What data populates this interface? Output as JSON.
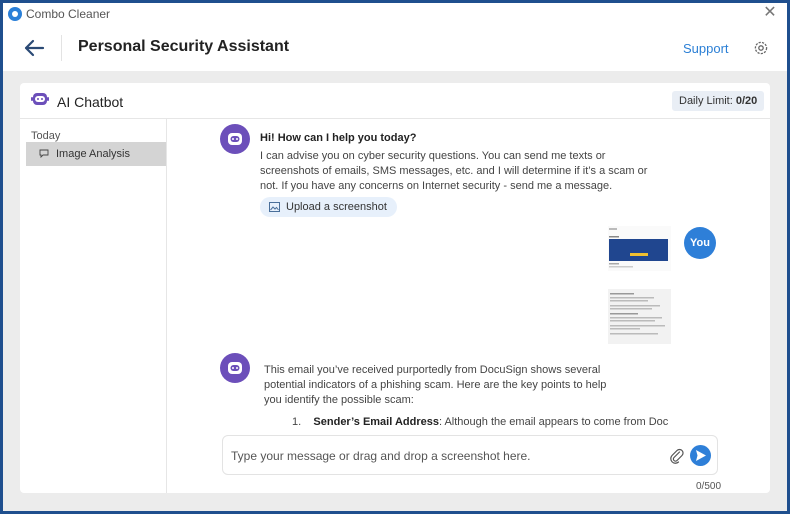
{
  "titlebar": {
    "app_name": "Combo Cleaner",
    "close_icon": "close-icon"
  },
  "header": {
    "title": "Personal Security Assistant",
    "support_label": "Support",
    "back_icon": "arrow-left-icon",
    "settings_icon": "gear-icon"
  },
  "panel": {
    "title": "AI Chatbot",
    "daily_limit_label": "Daily Limit: ",
    "daily_limit_value": "0/20"
  },
  "sidebar": {
    "group_label": "Today",
    "items": [
      {
        "label": "Image Analysis",
        "icon": "chat-bubble-icon"
      }
    ]
  },
  "chat": {
    "greeting": "Hi! How can I help you today?",
    "intro": "I can advise you on cyber security questions. You can send me texts or screenshots of emails, SMS messages, etc. and I will determine if it’s a scam or not. If you have any concerns on Internet security - send me a message.",
    "upload_label": "Upload a screenshot",
    "user_label": "You",
    "response": "This email you’ve received purportedly from DocuSign shows several potential indicators of a phishing scam. Here are the key points to help you identify the possible scam:",
    "point_number": "1.",
    "point_title": "Sender’s Email Address",
    "point_text": ": Although the email appears to come from Doc"
  },
  "input": {
    "placeholder": "Type your message or drag and drop a screenshot here.",
    "value": "",
    "char_count": "0/500"
  },
  "colors": {
    "accent": "#2e7fd8",
    "bot": "#6c4fba",
    "frame": "#1f4f8e"
  }
}
